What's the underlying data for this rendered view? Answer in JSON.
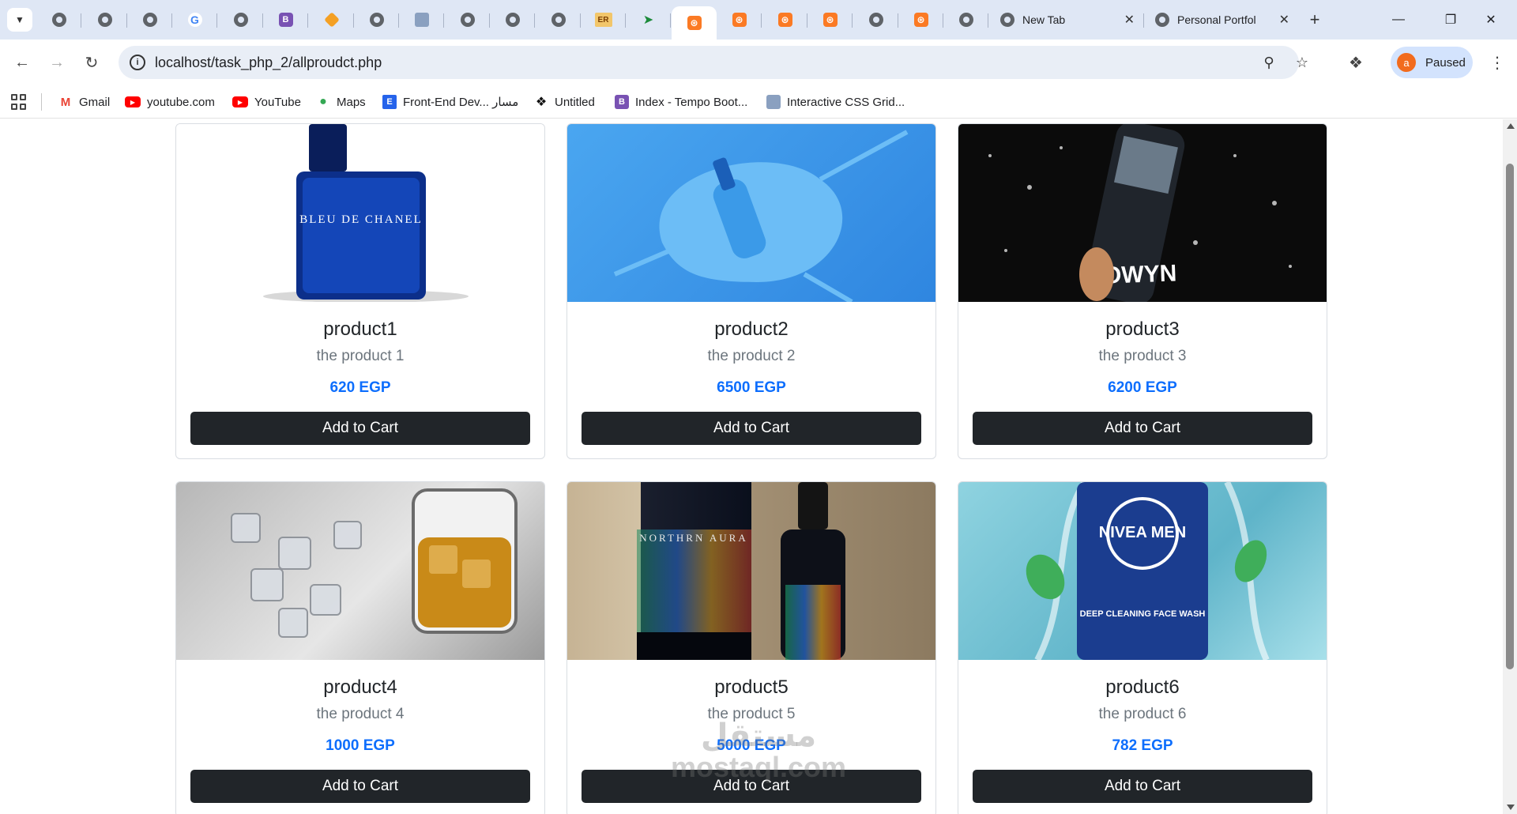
{
  "browser": {
    "tabs": [
      {
        "icon": "globe-icon"
      },
      {
        "icon": "globe-icon"
      },
      {
        "icon": "globe-icon"
      },
      {
        "icon": "google-icon"
      },
      {
        "icon": "globe-icon"
      },
      {
        "icon": "bootstrap-icon"
      },
      {
        "icon": "diamond-icon"
      },
      {
        "icon": "globe-icon"
      },
      {
        "icon": "box-icon"
      },
      {
        "icon": "globe-icon"
      },
      {
        "icon": "globe-icon"
      },
      {
        "icon": "globe-icon"
      },
      {
        "icon": "er-icon"
      },
      {
        "icon": "bird-icon"
      },
      {
        "icon": "xampp-icon",
        "active": true
      },
      {
        "icon": "xampp-icon"
      },
      {
        "icon": "xampp-icon"
      },
      {
        "icon": "xampp-icon"
      },
      {
        "icon": "globe-icon"
      },
      {
        "icon": "xampp-icon"
      },
      {
        "icon": "globe-icon"
      }
    ],
    "er_label": "ER",
    "b_label": "B",
    "g_label": "G",
    "named_tabs": [
      {
        "title": "New Tab",
        "icon": "chrome-icon"
      },
      {
        "title": "Personal Portfol",
        "icon": "globe-icon"
      }
    ],
    "url": "localhost/task_php_2/allproudct.php",
    "profile": {
      "initial": "a",
      "label": "Paused"
    },
    "bookmarks": [
      {
        "label": "Gmail",
        "icon": "gmail-icon"
      },
      {
        "label": "youtube.com",
        "icon": "youtube-icon"
      },
      {
        "label": "YouTube",
        "icon": "youtube-icon"
      },
      {
        "label": "Maps",
        "icon": "maps-icon"
      },
      {
        "label": "Front-End Dev... مسار",
        "icon": "e-icon"
      },
      {
        "label": "Untitled",
        "icon": "untitled-icon"
      },
      {
        "label": "Index - Tempo Boot...",
        "icon": "bootstrap-icon"
      },
      {
        "label": "Interactive CSS Grid...",
        "icon": "box-icon"
      }
    ],
    "bookmark_e": "E",
    "bookmark_b": "B"
  },
  "products": [
    {
      "title": "product1",
      "description": "the product 1",
      "price": "620 EGP",
      "button": "Add to Cart",
      "bottle_text": "BLEU DE CHANEL"
    },
    {
      "title": "product2",
      "description": "the product 2",
      "price": "6500 EGP",
      "button": "Add to Cart"
    },
    {
      "title": "product3",
      "description": "the product 3",
      "price": "6200 EGP",
      "button": "Add to Cart",
      "image_text": "OWYN"
    },
    {
      "title": "product4",
      "description": "the product 4",
      "price": "1000 EGP",
      "button": "Add to Cart"
    },
    {
      "title": "product5",
      "description": "the product 5",
      "price": "5000 EGP",
      "button": "Add to Cart",
      "image_text": "NORTHRN AURA"
    },
    {
      "title": "product6",
      "description": "the product 6",
      "price": "782 EGP",
      "button": "Add to Cart",
      "image_text": "NIVEA MEN",
      "image_sub": "DEEP CLEANING FACE WASH"
    }
  ],
  "watermark": {
    "line1": "مستقل",
    "line2": "mostaql.com"
  },
  "colors": {
    "price": "#0d6efd",
    "button": "#212529",
    "tabstrip": "#dfe7f5"
  }
}
